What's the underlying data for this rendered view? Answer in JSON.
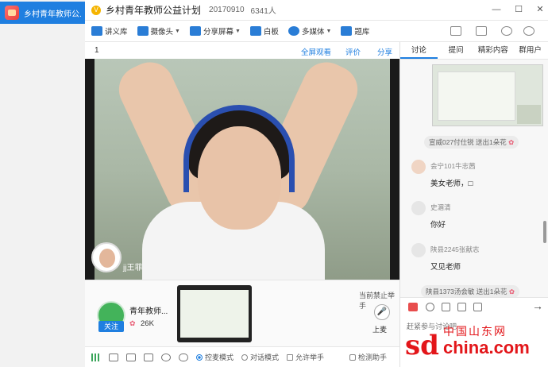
{
  "rail": {
    "title": "乡村青年教师公..."
  },
  "titlebar": {
    "title": "乡村青年教师公益计划",
    "room_id": "20170910",
    "viewers": "6341人"
  },
  "toolbar": {
    "items": [
      {
        "label": "讲义库",
        "icon": "library-icon"
      },
      {
        "label": "摄像头",
        "icon": "camera-icon"
      },
      {
        "label": "分享屏幕",
        "icon": "share-screen-icon"
      },
      {
        "label": "白板",
        "icon": "whiteboard-icon"
      },
      {
        "label": "多媒体",
        "icon": "media-icon"
      },
      {
        "label": "题库",
        "icon": "question-bank-icon"
      }
    ]
  },
  "stage": {
    "page_index": "1",
    "fullscreen": "全屏观看",
    "rate": "评价",
    "share": "分享",
    "camera_owner": "jj王菲"
  },
  "info": {
    "tutor_name": "青年教师...",
    "follow_label": "关注",
    "flowers": "26K",
    "hand_status": "当前禁止举手",
    "upmic_label": "上麦"
  },
  "controls": {
    "mode_mic": "控麦模式",
    "mode_talk": "对话模式",
    "allow_hand": "允许举手",
    "check_helper": "检测助手"
  },
  "panel": {
    "tabs": [
      "讨论",
      "提问",
      "精彩内容",
      "群用户"
    ],
    "gift1": "宣威027付仕锐 送出1朵花",
    "messages": [
      {
        "name": "会宁101牛志茜",
        "text": "美女老师，□"
      },
      {
        "name": "史湄清",
        "text": "你好"
      },
      {
        "name": "陕县2245张献志",
        "text": "又见老师"
      }
    ],
    "gift2": "陕县1373汤会敏 送出1朵花",
    "input_placeholder": "赶紧参与讨论吧~"
  },
  "watermark": {
    "cn": "中国山东网",
    "sd": "sd",
    "china": "china.com"
  }
}
